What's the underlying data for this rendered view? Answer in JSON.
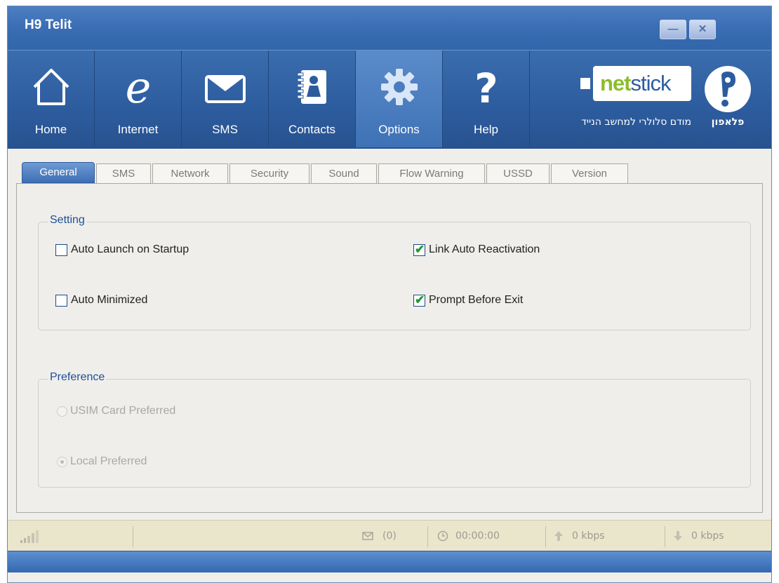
{
  "window": {
    "title": "H9 Telit"
  },
  "toolbar": {
    "buttons": [
      {
        "label": "Home",
        "icon": "home-icon"
      },
      {
        "label": "Internet",
        "icon": "internet-icon"
      },
      {
        "label": "SMS",
        "icon": "envelope-icon"
      },
      {
        "label": "Contacts",
        "icon": "contacts-icon"
      },
      {
        "label": "Options",
        "icon": "gear-icon"
      },
      {
        "label": "Help",
        "icon": "question-icon"
      }
    ],
    "active": "Options",
    "brand": {
      "word_part1": "net",
      "word_part2": "stick",
      "subtitle": "מודם סלולרי למחשב הנייד",
      "logo_text": "פלאפון"
    }
  },
  "tabs": [
    "General",
    "SMS",
    "Network",
    "Security",
    "Sound",
    "Flow Warning",
    "USSD",
    "Version"
  ],
  "active_tab": "General",
  "setting": {
    "legend": "Setting",
    "options": [
      {
        "label": "Auto Launch on Startup",
        "checked": false
      },
      {
        "label": "Link Auto Reactivation",
        "checked": true
      },
      {
        "label": "Auto Minimized",
        "checked": false
      },
      {
        "label": "Prompt Before Exit",
        "checked": true
      }
    ]
  },
  "preference": {
    "legend": "Preference",
    "options": [
      {
        "label": "USIM Card Preferred",
        "selected": false
      },
      {
        "label": "Local Preferred",
        "selected": true
      }
    ]
  },
  "status": {
    "messages": "(0)",
    "duration": "00:00:00",
    "upload": "0 kbps",
    "download": "0 kbps"
  },
  "colors": {
    "titlebar": "#3a6db3",
    "toolbar": "#2d5c9e",
    "accent_green": "#8cbd2a",
    "label_blue": "#1d4f9a"
  }
}
